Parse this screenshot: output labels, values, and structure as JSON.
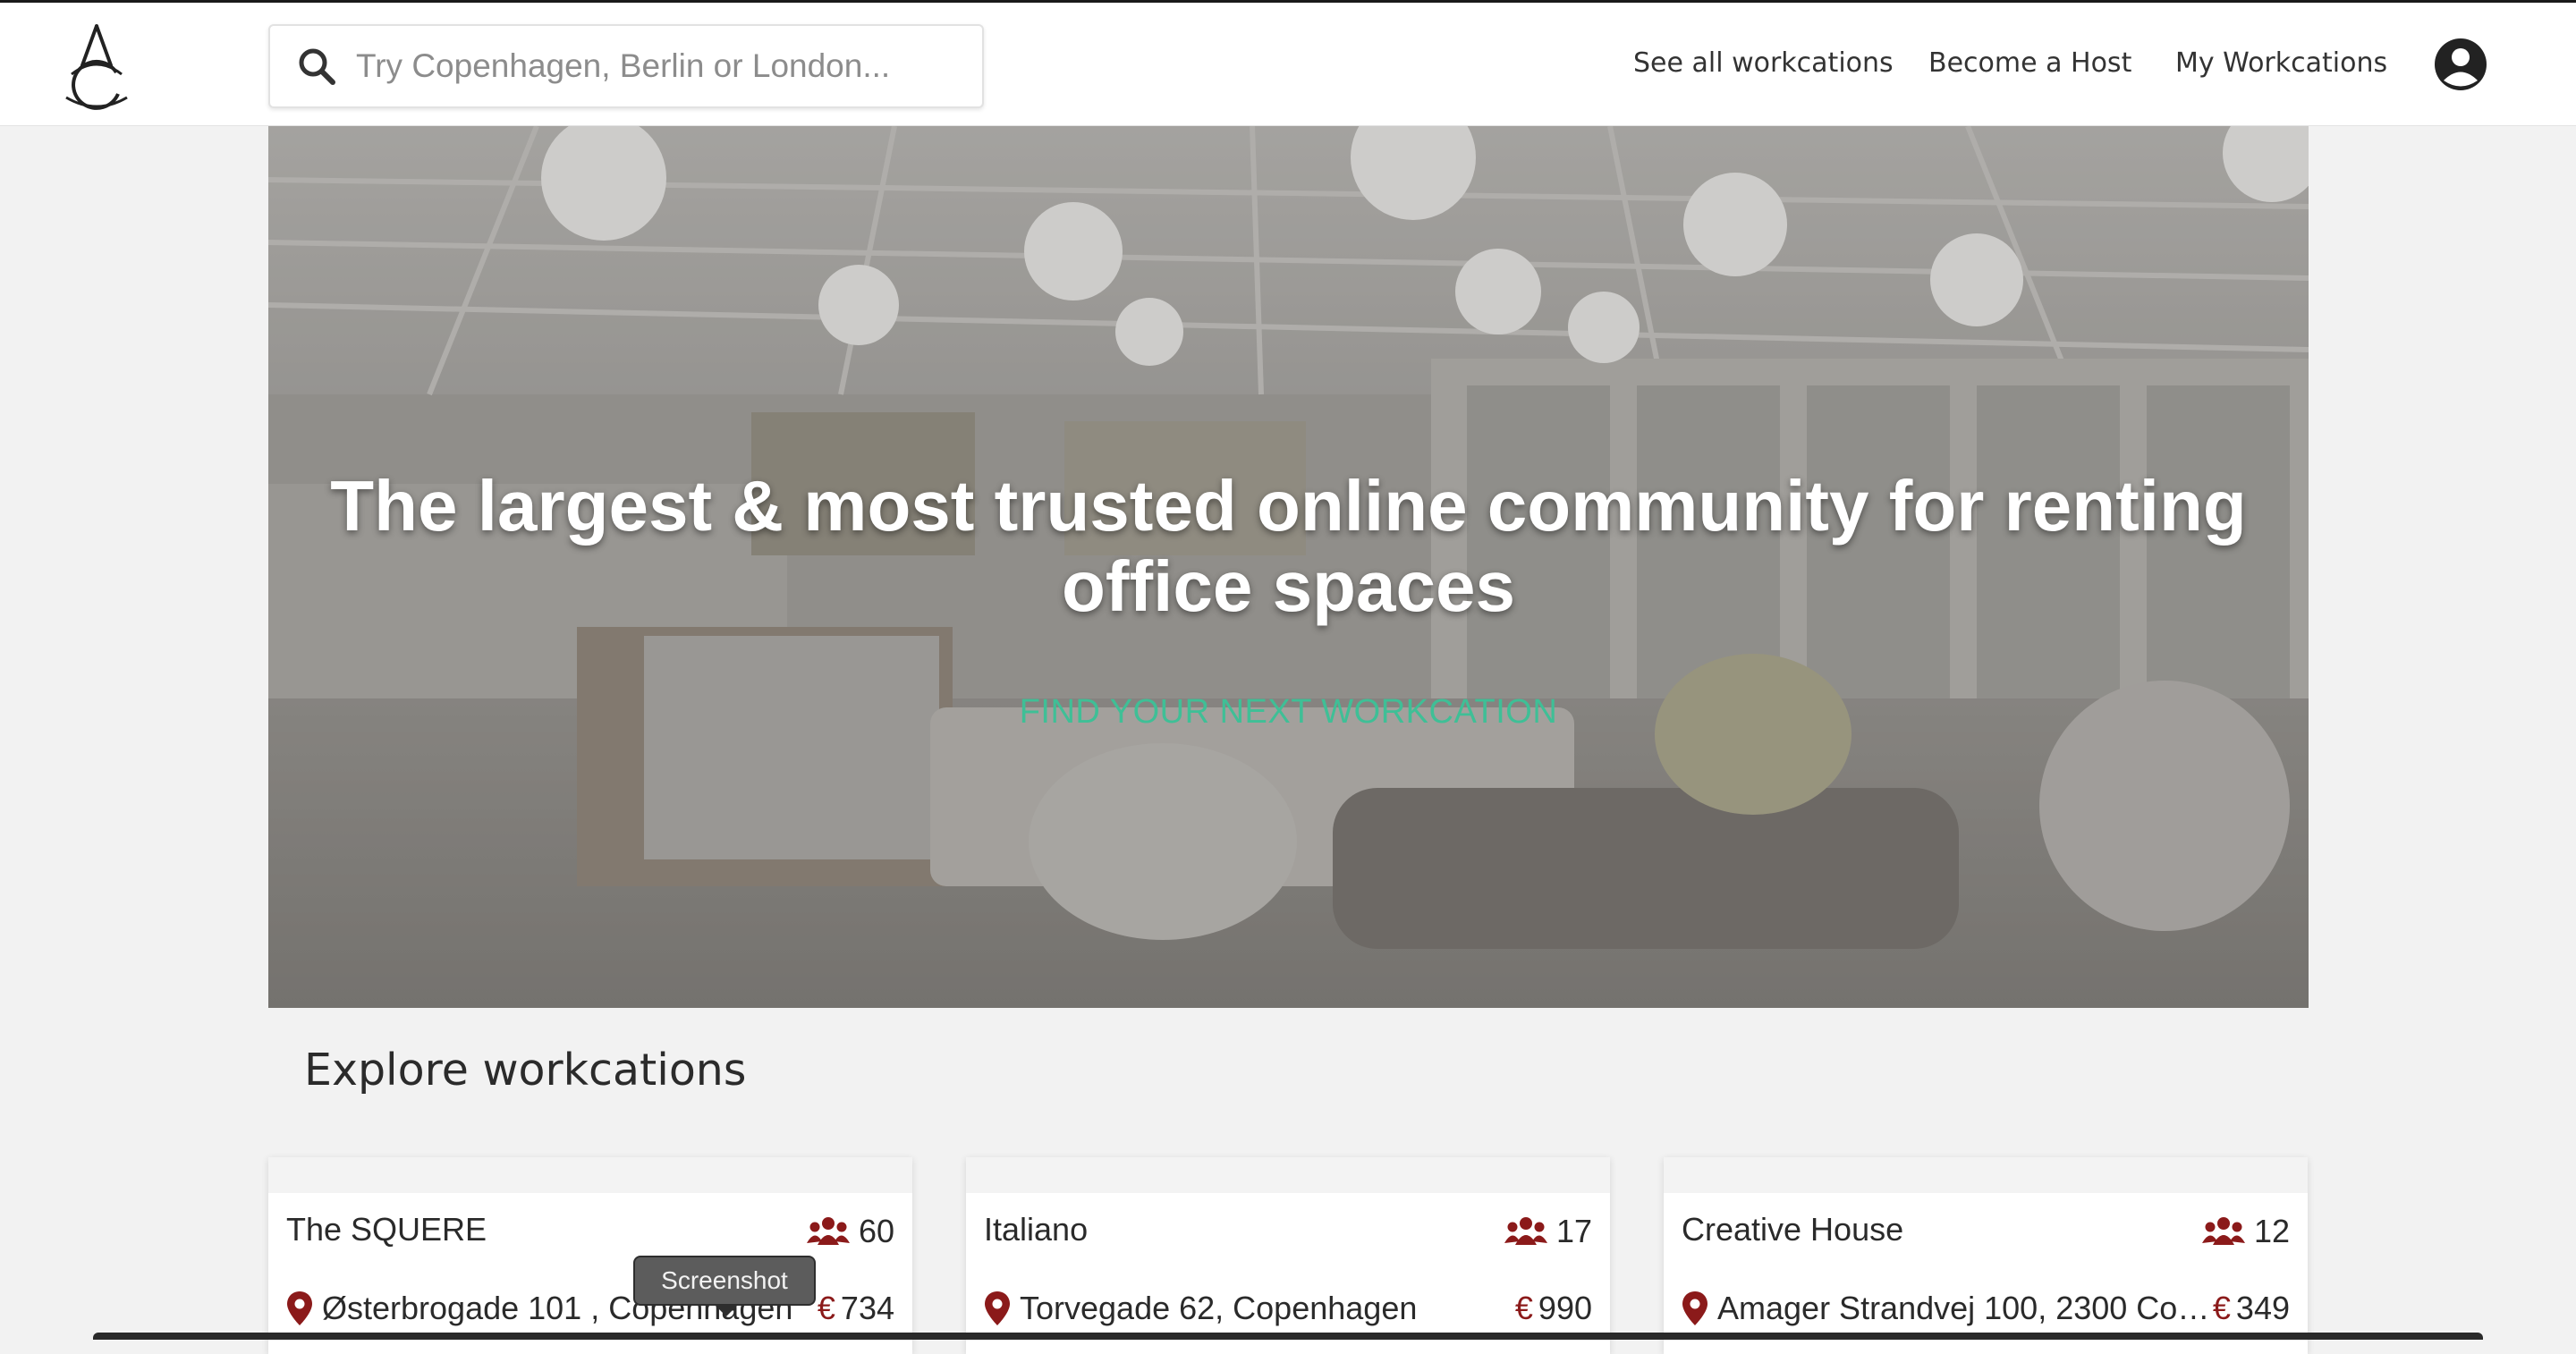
{
  "search": {
    "placeholder": "Try Copenhagen, Berlin or London..."
  },
  "nav": {
    "see_all": "See all workcations",
    "become_host": "Become a Host",
    "my_workcations": "My Workcations"
  },
  "hero": {
    "title": "The largest & most trusted online community for renting office spaces",
    "cta": "FIND YOUR NEXT WORKCATION"
  },
  "section_title": "Explore workcations",
  "cards": [
    {
      "name": "The SQUERE",
      "capacity": "60",
      "address": "Østerbrogade 101 , Copenhagen",
      "currency": "€",
      "price": "734"
    },
    {
      "name": "Italiano",
      "capacity": "17",
      "address": "Torvegade 62, Copenhagen",
      "currency": "€",
      "price": "990"
    },
    {
      "name": "Creative House",
      "capacity": "12",
      "address": "Amager Strandvej 100, 2300 Co…",
      "currency": "€",
      "price": "349"
    }
  ],
  "tooltip": "Screenshot",
  "colors": {
    "accent": "#3fbf96",
    "icon_red": "#8b1a1a"
  }
}
